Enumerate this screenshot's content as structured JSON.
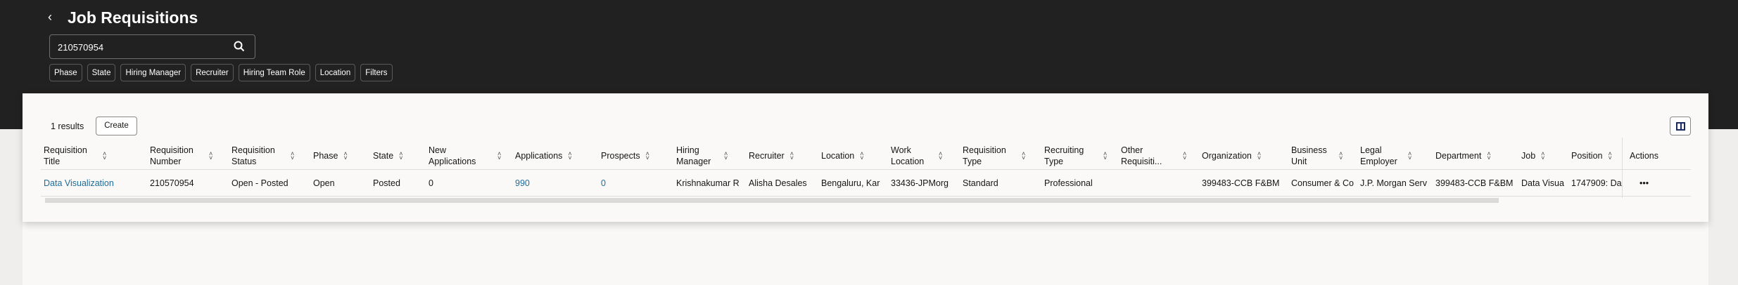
{
  "header": {
    "title": "Job Requisitions",
    "search_value": "210570954"
  },
  "filters": [
    "Phase",
    "State",
    "Hiring Manager",
    "Recruiter",
    "Hiring Team Role",
    "Location",
    "Filters"
  ],
  "toolbar": {
    "results": "1 results",
    "create": "Create"
  },
  "table": {
    "columns": [
      "Requisition Title",
      "Requisition Number",
      "Requisition Status",
      "Phase",
      "State",
      "New Applications",
      "Applications",
      "Prospects",
      "Hiring Manager",
      "Recruiter",
      "Location",
      "Work Location",
      "Requisition Type",
      "Recruiting Type",
      "Other Requisiti...",
      "Organization",
      "Business Unit",
      "Legal Employer",
      "Department",
      "Job",
      "Position",
      "Actions"
    ],
    "rows": [
      [
        "Data Visualization",
        "210570954",
        "Open - Posted",
        "Open",
        "Posted",
        "0",
        "990",
        "0",
        "Krishnakumar R",
        "Alisha Desales",
        "Bengaluru, Kar",
        "33436-JPMorg",
        "Standard",
        "Professional",
        "",
        "399483-CCB F&BM",
        "Consumer & Co",
        "J.P. Morgan Serv",
        "399483-CCB F&BM",
        "Data Visua",
        "1747909: Da",
        "•••"
      ]
    ]
  }
}
